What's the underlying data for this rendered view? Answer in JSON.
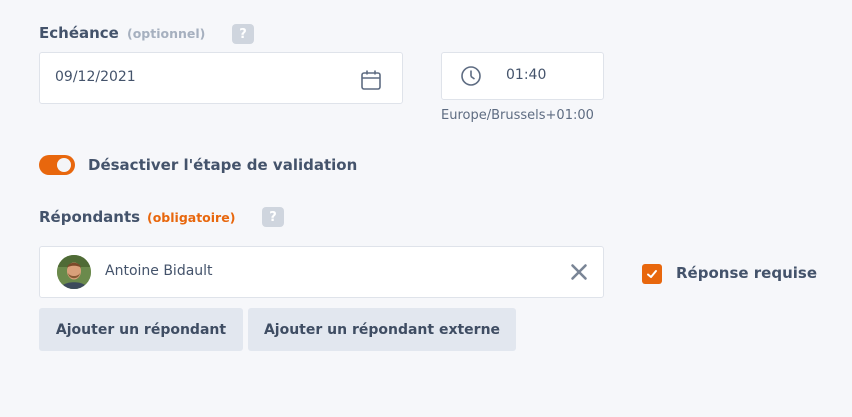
{
  "deadline": {
    "label": "Echéance",
    "optional_hint": "(optionnel)",
    "help_badge": "?",
    "date_value": "09/12/2021",
    "time_value": "01:40",
    "timezone": "Europe/Brussels+01:00",
    "icons": {
      "date": "calendar-icon",
      "time": "clock-icon"
    }
  },
  "validation_toggle": {
    "label": "Désactiver l'étape de validation",
    "enabled": true
  },
  "respondents": {
    "label": "Répondants",
    "required_hint": "(obligatoire)",
    "help_badge": "?",
    "selected": [
      {
        "name": "Antoine Bidault",
        "remove_icon": "close-icon"
      }
    ],
    "response_required": {
      "label": "Réponse requise",
      "checked": true
    },
    "buttons": {
      "add": "Ajouter un répondant",
      "add_external": "Ajouter un répondant externe"
    }
  },
  "colors": {
    "accent": "#e8670d",
    "text": "#44536b",
    "muted": "#a6b0bf",
    "button_bg": "#e2e7ef",
    "page_bg": "#f6f7fa"
  }
}
